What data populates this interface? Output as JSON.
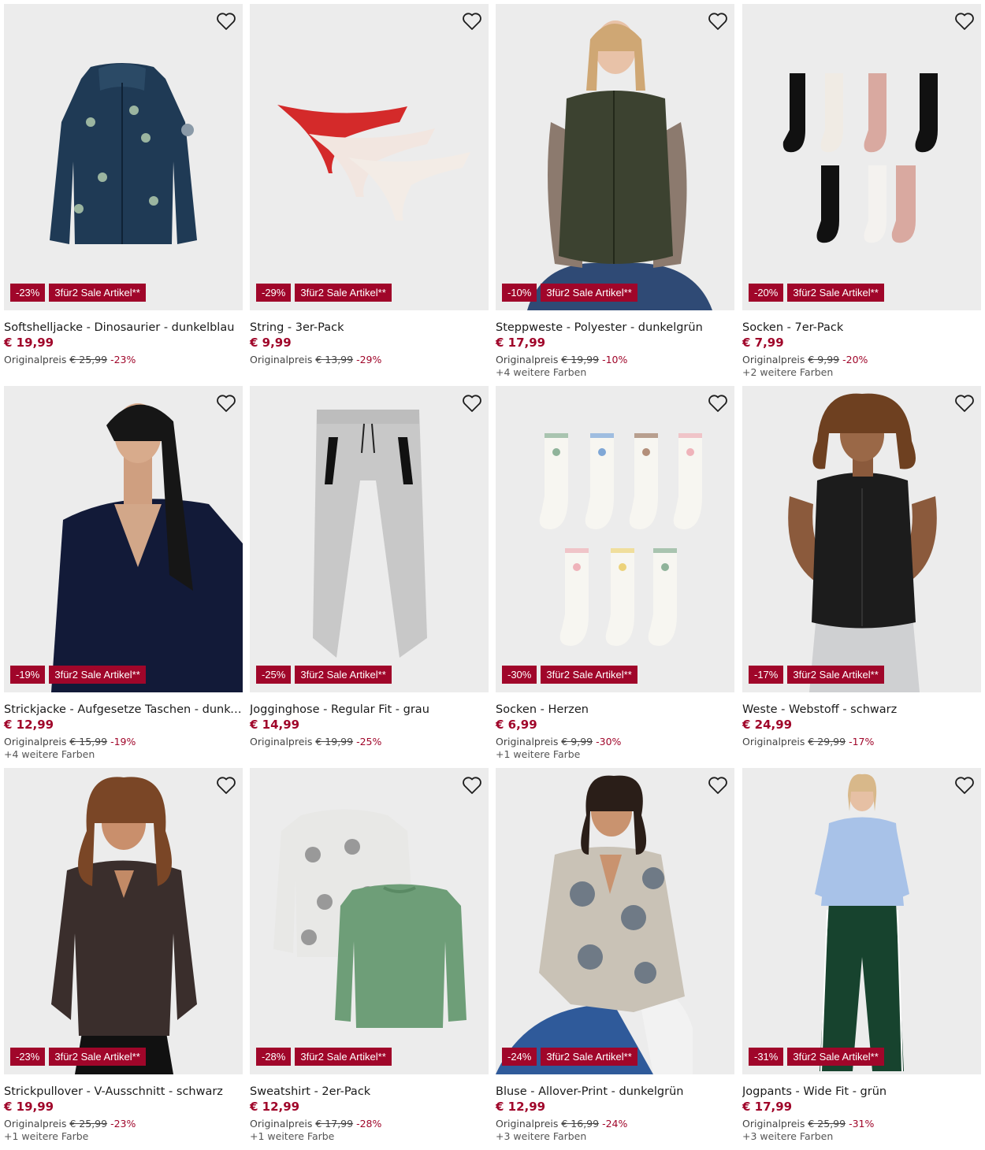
{
  "colors": {
    "accent": "#a0062a",
    "image_bg": "#ececec"
  },
  "icons": {
    "wishlist": "heart-outline-icon"
  },
  "products": [
    {
      "title": "Softshelljacke - Dinosaurier - dunkelblau",
      "price": "€ 19,99",
      "orig_label": "Originalpreis",
      "orig_price": "€ 25,99",
      "discount": "-23%",
      "promo": "3für2 Sale Artikel**",
      "colors_note": ""
    },
    {
      "title": "String - 3er-Pack",
      "price": "€ 9,99",
      "orig_label": "Originalpreis",
      "orig_price": "€ 13,99",
      "discount": "-29%",
      "promo": "3für2 Sale Artikel**",
      "colors_note": ""
    },
    {
      "title": "Steppweste - Polyester - dunkelgrün",
      "price": "€ 17,99",
      "orig_label": "Originalpreis",
      "orig_price": "€ 19,99",
      "discount": "-10%",
      "promo": "3für2 Sale Artikel**",
      "colors_note": "+4 weitere Farben"
    },
    {
      "title": "Socken - 7er-Pack",
      "price": "€ 7,99",
      "orig_label": "Originalpreis",
      "orig_price": "€ 9,99",
      "discount": "-20%",
      "promo": "3für2 Sale Artikel**",
      "colors_note": "+2 weitere Farben"
    },
    {
      "title": "Strickjacke - Aufgesetze Taschen - dunkelbl...",
      "price": "€ 12,99",
      "orig_label": "Originalpreis",
      "orig_price": "€ 15,99",
      "discount": "-19%",
      "promo": "3für2 Sale Artikel**",
      "colors_note": "+4 weitere Farben"
    },
    {
      "title": "Jogginghose - Regular Fit - grau",
      "price": "€ 14,99",
      "orig_label": "Originalpreis",
      "orig_price": "€ 19,99",
      "discount": "-25%",
      "promo": "3für2 Sale Artikel**",
      "colors_note": ""
    },
    {
      "title": "Socken - Herzen",
      "price": "€ 6,99",
      "orig_label": "Originalpreis",
      "orig_price": "€ 9,99",
      "discount": "-30%",
      "promo": "3für2 Sale Artikel**",
      "colors_note": "+1 weitere Farbe"
    },
    {
      "title": "Weste - Webstoff - schwarz",
      "price": "€ 24,99",
      "orig_label": "Originalpreis",
      "orig_price": "€ 29,99",
      "discount": "-17%",
      "promo": "3für2 Sale Artikel**",
      "colors_note": ""
    },
    {
      "title": "Strickpullover - V-Ausschnitt - schwarz",
      "price": "€ 19,99",
      "orig_label": "Originalpreis",
      "orig_price": "€ 25,99",
      "discount": "-23%",
      "promo": "3für2 Sale Artikel**",
      "colors_note": "+1 weitere Farbe"
    },
    {
      "title": "Sweatshirt - 2er-Pack",
      "price": "€ 12,99",
      "orig_label": "Originalpreis",
      "orig_price": "€ 17,99",
      "discount": "-28%",
      "promo": "3für2 Sale Artikel**",
      "colors_note": "+1 weitere Farbe"
    },
    {
      "title": "Bluse - Allover-Print - dunkelgrün",
      "price": "€ 12,99",
      "orig_label": "Originalpreis",
      "orig_price": "€ 16,99",
      "discount": "-24%",
      "promo": "3für2 Sale Artikel**",
      "colors_note": "+3 weitere Farben"
    },
    {
      "title": "Jogpants - Wide Fit - grün",
      "price": "€ 17,99",
      "orig_label": "Originalpreis",
      "orig_price": "€ 25,99",
      "discount": "-31%",
      "promo": "3für2 Sale Artikel**",
      "colors_note": "+3 weitere Farben"
    }
  ]
}
